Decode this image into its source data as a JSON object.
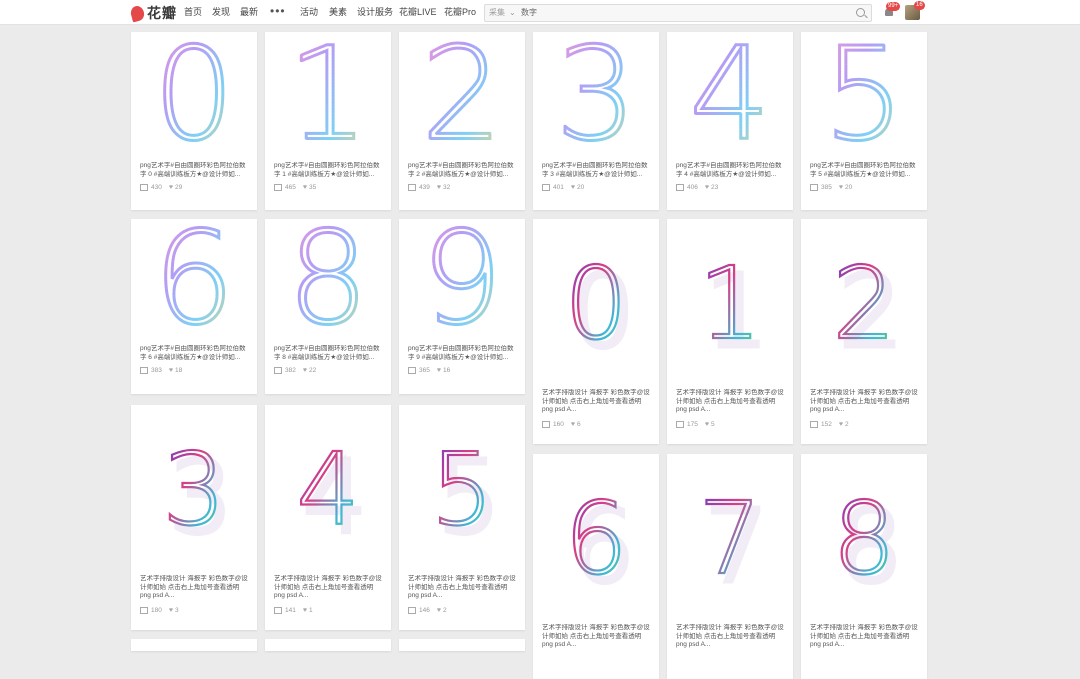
{
  "header": {
    "logo_text": "花瓣",
    "nav": [
      "首页",
      "发现",
      "最新"
    ],
    "more": "•••",
    "nav2": [
      "活动",
      "美素",
      "设计服务",
      "花瓣LIVE",
      "花瓣Pro"
    ],
    "search": {
      "category": "采集",
      "value": "数字"
    },
    "badge_msg": "99+",
    "badge_user": "16"
  },
  "pins": [
    {
      "digit": "0",
      "style": "ring",
      "desc": "png艺术字#自由圆圈环彩色阿拉伯数字 0 #高端训练板方★@设计师如...",
      "repins": "430",
      "likes": "29"
    },
    {
      "digit": "1",
      "style": "ring",
      "desc": "png艺术字#自由圆圈环彩色阿拉伯数字 1 #高端训练板方★@设计师如...",
      "repins": "465",
      "likes": "35"
    },
    {
      "digit": "2",
      "style": "ring",
      "desc": "png艺术字#自由圆圈环彩色阿拉伯数字 2 #高端训练板方★@设计师如...",
      "repins": "439",
      "likes": "32"
    },
    {
      "digit": "3",
      "style": "ring",
      "desc": "png艺术字#自由圆圈环彩色阿拉伯数字 3 #高端训练板方★@设计师如...",
      "repins": "401",
      "likes": "20"
    },
    {
      "digit": "4",
      "style": "ring",
      "desc": "png艺术字#自由圆圈环彩色阿拉伯数字 4 #高端训练板方★@设计师如...",
      "repins": "406",
      "likes": "23"
    },
    {
      "digit": "5",
      "style": "ring",
      "desc": "png艺术字#自由圆圈环彩色阿拉伯数字 5 #高端训练板方★@设计师如...",
      "repins": "385",
      "likes": "20"
    },
    {
      "digit": "6",
      "style": "ring",
      "desc": "png艺术字#自由圆圈环彩色阿拉伯数字 6 #高端训练板方★@设计师如...",
      "repins": "383",
      "likes": "18"
    },
    {
      "digit": "8",
      "style": "ring",
      "desc": "png艺术字#自由圆圈环彩色阿拉伯数字 8 #高端训练板方★@设计师如...",
      "repins": "382",
      "likes": "22"
    },
    {
      "digit": "9",
      "style": "ring",
      "desc": "png艺术字#自由圆圈环彩色阿拉伯数字 9 #高端训练板方★@设计师如...",
      "repins": "365",
      "likes": "16"
    },
    {
      "digit": "0",
      "style": "neon",
      "desc": "艺术字排版设计 海报字 彩色数字@设计师如始 点击右上角加号查看透明 png psd A...",
      "repins": "160",
      "likes": "6"
    },
    {
      "digit": "1",
      "style": "neon",
      "desc": "艺术字排版设计 海报字 彩色数字@设计师如始 点击右上角加号查看透明 png psd A...",
      "repins": "175",
      "likes": "5"
    },
    {
      "digit": "2",
      "style": "neon",
      "desc": "艺术字排版设计 海报字 彩色数字@设计师如始 点击右上角加号查看透明 png psd A...",
      "repins": "152",
      "likes": "2"
    },
    {
      "digit": "3",
      "style": "neon",
      "desc": "艺术字排版设计 海报字 彩色数字@设计师如始 点击右上角加号查看透明 png psd A...",
      "repins": "180",
      "likes": "3"
    },
    {
      "digit": "4",
      "style": "neon",
      "desc": "艺术字排版设计 海报字 彩色数字@设计师如始 点击右上角加号查看透明 png psd A...",
      "repins": "141",
      "likes": "1"
    },
    {
      "digit": "5",
      "style": "neon",
      "desc": "艺术字排版设计 海报字 彩色数字@设计师如始 点击右上角加号查看透明 png psd A...",
      "repins": "146",
      "likes": "2"
    },
    {
      "digit": "6",
      "style": "neon",
      "desc": "艺术字排版设计 海报字 彩色数字@设计师如始 点击右上角加号查看透明 png psd A...",
      "repins": "",
      "likes": ""
    },
    {
      "digit": "7",
      "style": "neon",
      "desc": "艺术字排版设计 海报字 彩色数字@设计师如始 点击右上角加号查看透明 png psd A...",
      "repins": "",
      "likes": ""
    },
    {
      "digit": "8",
      "style": "neon",
      "desc": "艺术字排版设计 海报字 彩色数字@设计师如始 点击右上角加号查看透明 png psd A...",
      "repins": "",
      "likes": ""
    }
  ]
}
